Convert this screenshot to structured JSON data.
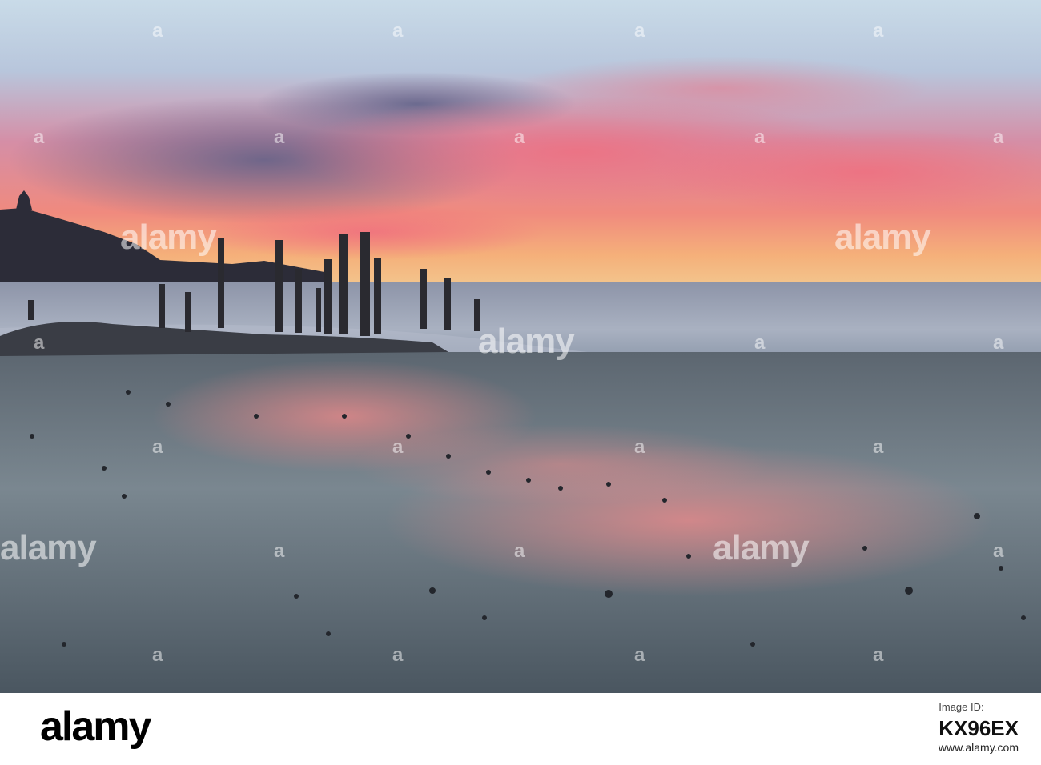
{
  "watermark": {
    "brand": "alamy",
    "letter": "a"
  },
  "footer": {
    "logo": "alamy",
    "image_id_label": "Image ID:",
    "image_id": "KX96EX",
    "url": "www.alamy.com"
  }
}
